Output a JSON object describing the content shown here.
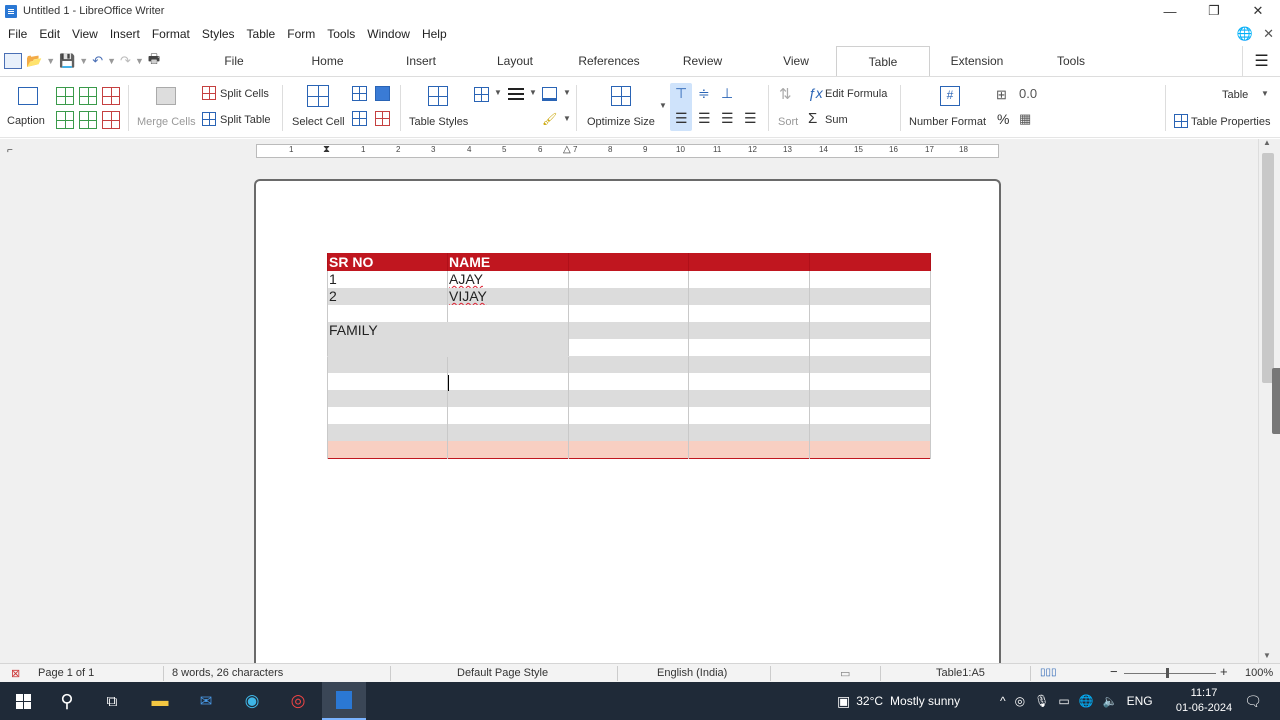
{
  "window": {
    "title": "Untitled 1 - LibreOffice Writer",
    "controls": [
      "—",
      "❐",
      "✕"
    ]
  },
  "menu": [
    "File",
    "Edit",
    "View",
    "Insert",
    "Format",
    "Styles",
    "Table",
    "Form",
    "Tools",
    "Window",
    "Help"
  ],
  "tabs": [
    "File",
    "Home",
    "Insert",
    "Layout",
    "References",
    "Review",
    "View",
    "Table",
    "Extension",
    "Tools"
  ],
  "active_tab": "Table",
  "ribbon": {
    "caption": "Caption",
    "merge_cells": "Merge Cells",
    "split_cells": "Split Cells",
    "split_table": "Split Table",
    "select_cell": "Select Cell",
    "table_styles": "Table Styles",
    "optimize_size": "Optimize Size",
    "sort": "Sort",
    "edit_formula": "Edit Formula",
    "sum": "Sum",
    "number_format": "Number Format",
    "table_dropdown": "Table",
    "table_properties": "Table Properties"
  },
  "ruler_ticks": [
    "1",
    "1",
    "2",
    "3",
    "4",
    "5",
    "6",
    "7",
    "8",
    "9",
    "10",
    "11",
    "12",
    "13",
    "14",
    "15",
    "16",
    "17",
    "18"
  ],
  "table": {
    "header": [
      "SR NO",
      "NAME",
      "",
      "",
      ""
    ],
    "row1": [
      "1",
      "AJAY",
      "",
      "",
      ""
    ],
    "row2": [
      "2",
      "VIJAY",
      "",
      "",
      ""
    ],
    "family": "FAMILY"
  },
  "status": {
    "page": "Page 1 of 1",
    "words": "8 words, 26 characters",
    "page_style": "Default Page Style",
    "language": "English (India)",
    "cell": "Table1:A5",
    "zoom": "100%"
  },
  "taskbar": {
    "weather_temp": "32°C",
    "weather_text": "Mostly sunny",
    "lang": "ENG",
    "time": "11:17",
    "date": "01-06-2024"
  },
  "colors": {
    "header_red": "#c0161f",
    "band_gray": "#dcdcdc",
    "last_row": "#f8cfc2",
    "taskbar": "#1f2a38"
  }
}
